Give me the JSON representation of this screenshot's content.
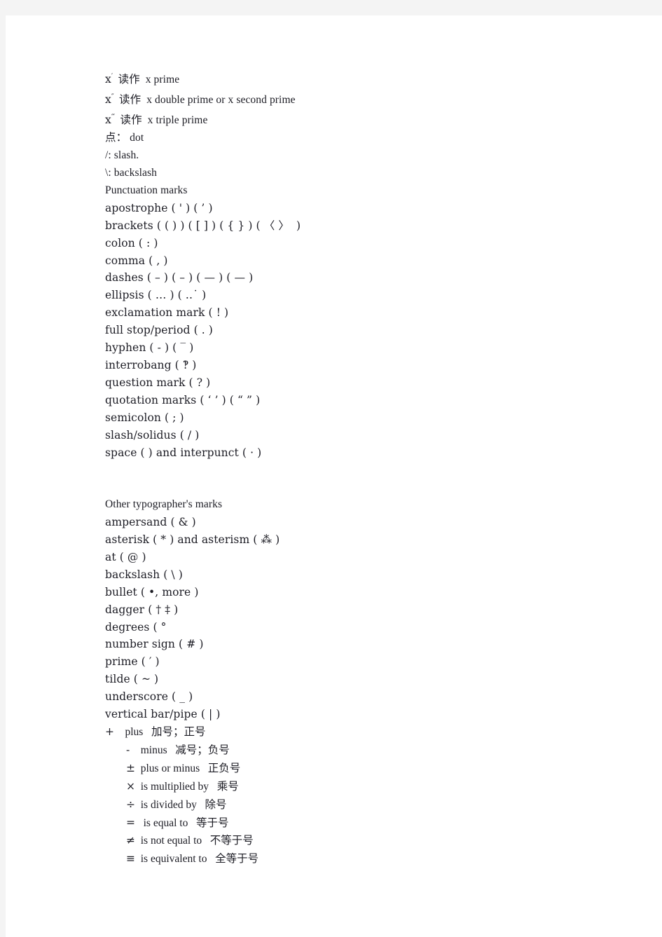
{
  "document": {
    "background_color": "#f4f4f4",
    "page_color": "#ffffff",
    "text_color": "#1c1c24",
    "prime_notation": [
      {
        "symbol": "x",
        "primes": "′",
        "reading": "读作",
        "english": "x prime"
      },
      {
        "symbol": "x",
        "primes": "″",
        "reading": "读作",
        "english": "x double prime or x second prime"
      },
      {
        "symbol": "x",
        "primes": "‴",
        "reading": "读作",
        "english": "x triple prime"
      }
    ],
    "misc_lines": [
      "点： dot",
      "/: slash.",
      "\\: backslash"
    ],
    "punctuation_heading": "Punctuation marks",
    "punctuation_items": [
      "apostrophe ( ' ) ( ’ )",
      "brackets ( ( ) ) ( [ ] ) ( { } ) ( 〈 〉  )",
      "colon ( : )",
      "comma ( , )",
      "dashes ( – ) ( – ) ( — ) ( — )",
      "ellipsis ( … ) ( ‥˙ )",
      "exclamation mark ( ! )",
      "full stop/period ( . )",
      "hyphen ( - ) ( ‾ )",
      "interrobang ( ‽ )",
      "question mark ( ? )",
      "quotation marks ( ‘ ’ ) ( “ ” )",
      "semicolon ( ; )",
      "slash/solidus ( / )",
      "space ( ) and interpunct ( · )"
    ],
    "typographer_heading": "Other typographer's marks",
    "typographer_items": [
      "ampersand ( & )",
      "asterisk ( * ) and asterism ( ⁂ )",
      "at ( @ )",
      "backslash ( \\ )",
      "bullet ( •, more )",
      "dagger ( † ‡ )",
      "degrees ( °",
      "number sign ( # )",
      "prime ( ′ )",
      "tilde ( ~ )",
      "underscore ( _ )",
      "vertical bar/pipe ( | )"
    ],
    "math_operators": [
      {
        "symbol": "+",
        "english": "plus",
        "chinese": "加号；正号",
        "indented": false
      },
      {
        "symbol": "-",
        "english": "minus",
        "chinese": "减号；负号",
        "indented": true
      },
      {
        "symbol": "±",
        "english": "plus or minus",
        "chinese": "正负号",
        "indented": true
      },
      {
        "symbol": "×",
        "english": "is multiplied by",
        "chinese": "乘号",
        "indented": true
      },
      {
        "symbol": "÷",
        "english": "is divided by",
        "chinese": "除号",
        "indented": true
      },
      {
        "symbol": "=",
        "english": "is equal to",
        "chinese": "等于号",
        "indented": true
      },
      {
        "symbol": "≠",
        "english": "is not equal to",
        "chinese": "不等于号",
        "indented": true
      },
      {
        "symbol": "≡",
        "english": "is equivalent to",
        "chinese": "全等于号",
        "indented": true
      }
    ]
  }
}
